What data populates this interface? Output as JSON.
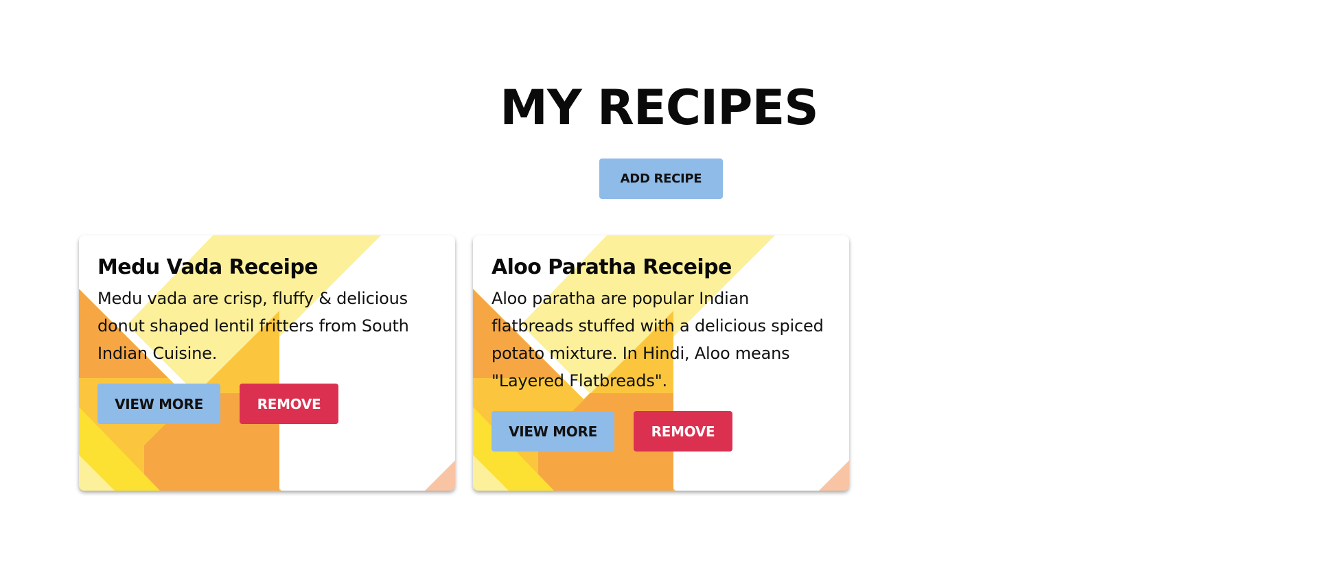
{
  "header": {
    "title": "MY RECIPES",
    "add_button_label": "ADD RECIPE"
  },
  "recipes": [
    {
      "title": "Medu Vada Receipe",
      "description": "Medu vada are crisp, fluffy & delicious donut shaped lentil fritters from South Indian Cuisine.",
      "view_label": "VIEW MORE",
      "remove_label": "REMOVE"
    },
    {
      "title": "Aloo Paratha Receipe",
      "description": "Aloo paratha are popular Indian flatbreads stuffed with a delicious spiced potato mixture. In Hindi, Aloo means \"Layered Flatbreads\".",
      "view_label": "VIEW MORE",
      "remove_label": "REMOVE"
    }
  ],
  "colors": {
    "primary_button": "#8fbbe8",
    "danger_button": "#dc3050",
    "pale_yellow": "#fdf09a",
    "yellow": "#fbc63e",
    "orange": "#f6a744",
    "bright_yellow": "#fde132",
    "peach": "#f8c4a4"
  }
}
